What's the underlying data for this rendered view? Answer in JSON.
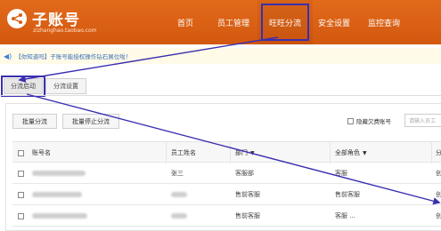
{
  "header": {
    "title": "子账号",
    "subtitle": "zizhanghao.taobao.com",
    "nav": [
      {
        "label": "首页",
        "active": false
      },
      {
        "label": "员工管理",
        "active": false
      },
      {
        "label": "旺旺分流",
        "active": true
      },
      {
        "label": "安全设置",
        "active": false
      },
      {
        "label": "监控查询",
        "active": false
      }
    ]
  },
  "tip": {
    "text": "【你知道吗】子账号能授权操作钻石展位啦！"
  },
  "tabs": [
    {
      "label": "分流启动",
      "active": true
    },
    {
      "label": "分流设置",
      "active": false
    }
  ],
  "toolbar": {
    "batch_divert": "批量分流",
    "batch_stop": "批量停止分流",
    "hide_arrears": "隐藏欠费账号",
    "search_placeholder": "请输入员工"
  },
  "table": {
    "headers": [
      "账号名",
      "员工姓名",
      "部门",
      "全部角色",
      "分"
    ],
    "rows": [
      {
        "staff": "张三",
        "dept": "客服部",
        "role": "客服",
        "extra": "创"
      },
      {
        "staff": "",
        "dept": "售前客服",
        "role": "售前客服",
        "extra": "创"
      },
      {
        "staff": "",
        "dept": "售前客服",
        "role": "客服 ...",
        "extra": "创"
      }
    ]
  },
  "colors": {
    "header_bg": "#d95f14",
    "annotation": "#3a2fb0",
    "link": "#3b6fb6"
  }
}
